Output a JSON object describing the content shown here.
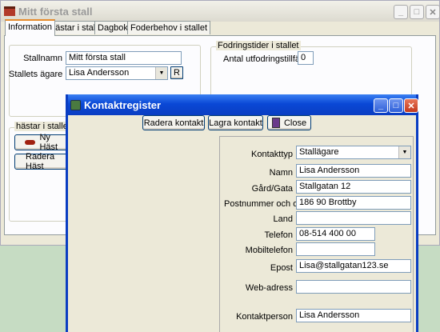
{
  "main": {
    "title": "Mitt första stall",
    "tabs": [
      "Information",
      "hästar i stallet",
      "Dagbok",
      "Foderbehov i stallet"
    ],
    "stallnamn_label": "Stallnamn",
    "stallnamn_value": "Mitt första stall",
    "agare_label": "Stallets ägare",
    "agare_value": "Lisa Andersson",
    "r_button": "R",
    "fodring_group": "Fodringstider i stallet",
    "fodring_label": "Antal utfodringstillfällen",
    "fodring_value": "0",
    "hastar_group": "hästar i stallet",
    "ny_hast": "Ny Häst",
    "radera_hast": "Radera Häst"
  },
  "dialog": {
    "title": "Kontaktregister",
    "radera": "Radera kontakt",
    "lagra": "Lagra kontakt",
    "close": "Close",
    "fields": {
      "kontakttyp": {
        "label": "Kontakttyp",
        "value": "Stallägare"
      },
      "namn": {
        "label": "Namn",
        "value": "Lisa Andersson"
      },
      "gata": {
        "label": "Gård/Gata",
        "value": "Stallgatan 12"
      },
      "postnr": {
        "label": "Postnummer och ort",
        "value": "186 90 Brottby"
      },
      "land": {
        "label": "Land",
        "value": ""
      },
      "telefon": {
        "label": "Telefon",
        "value": "08-514 400 00"
      },
      "mobil": {
        "label": "Mobiltelefon",
        "value": ""
      },
      "epost": {
        "label": "Epost",
        "value": "Lisa@stallgatan123.se"
      },
      "web": {
        "label": "Web-adress",
        "value": ""
      },
      "kontaktperson": {
        "label": "Kontaktperson",
        "value": "Lisa Andersson"
      }
    }
  },
  "colors": {
    "background": "#c6dcc3",
    "window": "#ece9d8",
    "dialog_titlebar": "#0a246a"
  }
}
